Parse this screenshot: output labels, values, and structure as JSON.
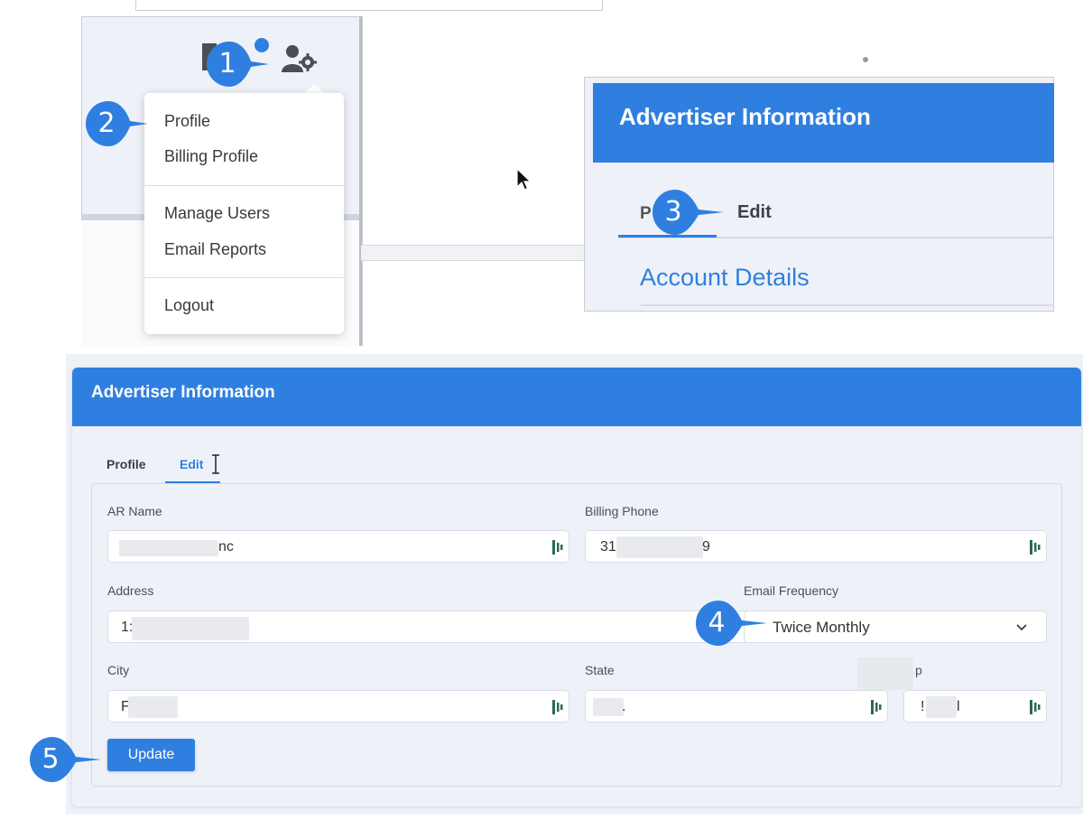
{
  "dropdown_panel": {
    "menu": {
      "group1": [
        "Profile",
        "Billing Profile"
      ],
      "group2": [
        "Manage Users",
        "Email Reports"
      ],
      "group3": [
        "Logout"
      ]
    }
  },
  "header_panel": {
    "title": "Advertiser Information",
    "tab_profile_partial": "P",
    "tab_edit": "Edit",
    "section_title": "Account Details"
  },
  "form_panel": {
    "title": "Advertiser Information",
    "tabs": {
      "profile": "Profile",
      "edit": "Edit"
    },
    "fields": {
      "ar_name": {
        "label": "AR Name",
        "value": "nc"
      },
      "billing_phone": {
        "label": "Billing Phone",
        "value_start": "31",
        "value_end": "9"
      },
      "address": {
        "label": "Address",
        "value": "1:"
      },
      "email_frequency": {
        "label": "Email Frequency",
        "value": "Twice Monthly"
      },
      "city": {
        "label": "City",
        "value": "F"
      },
      "state": {
        "label": "State",
        "value": "."
      },
      "zip": {
        "label": "p",
        "value_start": "!",
        "value_end": "l"
      }
    },
    "update_label": "Update"
  },
  "callouts": [
    "1",
    "2",
    "3",
    "4",
    "5"
  ],
  "colors": {
    "accent": "#2f7fe0",
    "panel_bg": "#eef2f8"
  }
}
